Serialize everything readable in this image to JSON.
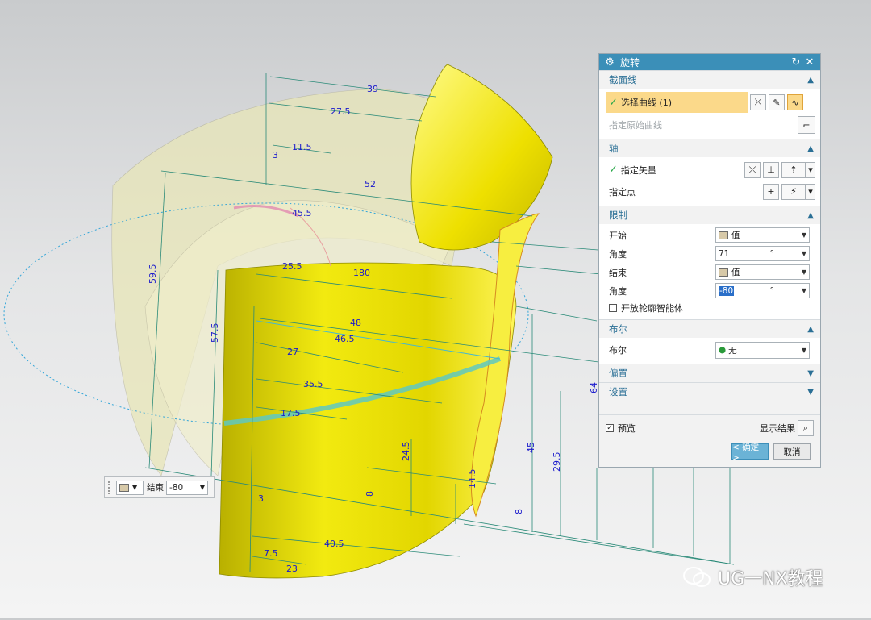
{
  "dialog": {
    "title": "旋转",
    "sections": {
      "section_curve": {
        "label": "截面线",
        "select_curve": "选择曲线 (1)",
        "specify_origin_curve": "指定原始曲线"
      },
      "axis": {
        "label": "轴",
        "specify_vector": "指定矢量",
        "specify_point": "指定点"
      },
      "limits": {
        "label": "限制",
        "start_label": "开始",
        "start_value": "值",
        "angle1_label": "角度",
        "angle1_value": "71",
        "angle1_unit": "°",
        "end_label": "结束",
        "end_value": "值",
        "angle2_label": "角度",
        "angle2_value": "-80",
        "angle2_unit": "°",
        "open_profile": "开放轮廓智能体"
      },
      "boolean": {
        "label": "布尔",
        "row_label": "布尔",
        "value": "无"
      },
      "offset": {
        "label": "偏置"
      },
      "settings": {
        "label": "设置"
      }
    },
    "preview_label": "预览",
    "show_result_label": "显示结果",
    "ok_label": "< 确定 >",
    "cancel_label": "取消"
  },
  "floating_toolbar": {
    "label": "结束",
    "value": "-80"
  },
  "dimensions": [
    "39",
    "27.5",
    "11.5",
    "3",
    "52",
    "45.5",
    "59.5",
    "57.5",
    "25.5",
    "180",
    "48",
    "46.5",
    "27",
    "35.5",
    "17.5",
    "24.5",
    "8",
    "14.5",
    "45",
    "29.5",
    "64",
    "8",
    "3",
    "40.5",
    "7.5",
    "23"
  ],
  "watermark": "UG一NX教程",
  "colors": {
    "title_bar": "#3b8fb8",
    "section_text": "#2a6f95",
    "highlight": "#fbd98a",
    "surface": "#e8e000",
    "dimension": "#1a1acc",
    "axis_line": "#2a8a78"
  }
}
